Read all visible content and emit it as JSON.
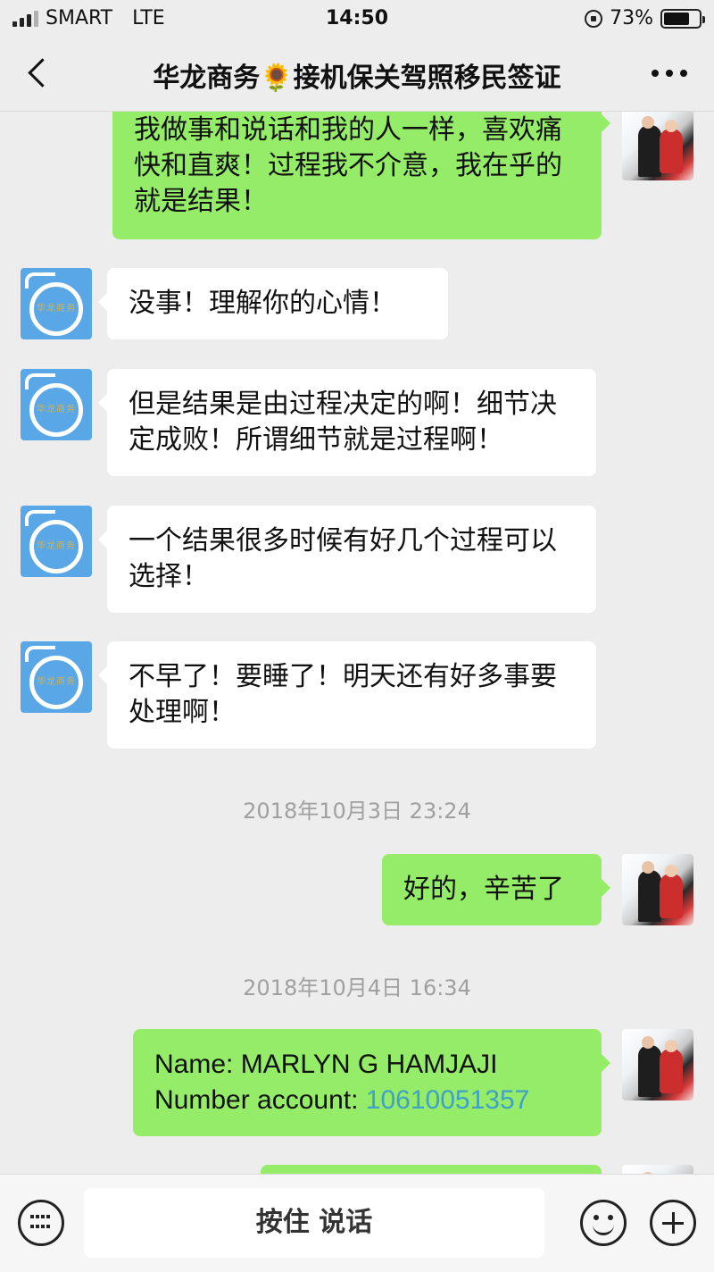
{
  "status_bar": {
    "carrier": "SMART",
    "network": "LTE",
    "time": "14:50",
    "battery_text": "73%",
    "battery_level": 0.73
  },
  "nav": {
    "title": "华龙商务🌻接机保关驾照移民签证"
  },
  "avatars": {
    "contact_logo_text": "华龙商务"
  },
  "messages": [
    {
      "side": "out",
      "text": "我做事和说话和我的人一样，喜欢痛快和直爽！过程我不介意，我在乎的就是结果！"
    },
    {
      "side": "in",
      "text": "没事！理解你的心情！"
    },
    {
      "side": "in",
      "text": "但是结果是由过程决定的啊！细节决定成败！所谓细节就是过程啊！"
    },
    {
      "side": "in",
      "text": "一个结果很多时候有好几个过程可以选择！"
    },
    {
      "side": "in",
      "text": "不早了！要睡了！明天还有好多事要处理啊！"
    },
    {
      "timestamp": "2018年10月3日 23:24"
    },
    {
      "side": "out",
      "text": "好的，辛苦了"
    },
    {
      "timestamp": "2018年10月4日 16:34"
    },
    {
      "side": "out",
      "name_line": "Name: MARLYN G HAMJAJI",
      "account_label": "Number account: ",
      "account_number": "10610051357"
    }
  ],
  "input_bar": {
    "hold_to_talk": "按住 说话"
  }
}
